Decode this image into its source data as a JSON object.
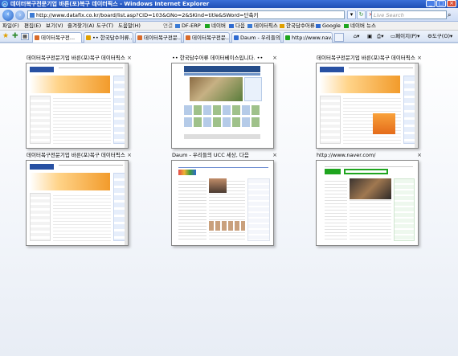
{
  "window": {
    "title": "데이터복구전문기업 바른(포)복구 데이터픽스 - Windows Internet Explorer"
  },
  "address_bar": {
    "url": "http://www.datafix.co.kr/board/list.asp?CID=103&GNo=2&SKind=title&SWord=단축키",
    "search_placeholder": "Live Search"
  },
  "menu": {
    "items": [
      "파일(F)",
      "편집(E)",
      "보기(V)",
      "즐겨찾기(A)",
      "도구(T)",
      "도움말(H)"
    ],
    "links_label": "연결",
    "links": [
      "DF-ERP",
      "네이버",
      "다음",
      "데이터픽스",
      "한국담수어류",
      "Google",
      "네이버 뉴스"
    ]
  },
  "tabs": {
    "items": [
      "데이터복구전...",
      "•• 한국담수어류...",
      "데이터복구전문...",
      "데이터복구전문...",
      "Daum - 우리들의...",
      "http://www.nav..."
    ],
    "commands": [
      "페이지(P)",
      "도구(O)"
    ]
  },
  "quick_tabs": [
    {
      "title": "데이터복구전문기업 바른(포)복구 데이터픽스",
      "kind": "datafix"
    },
    {
      "title": "•• 한국담수어류 데이터베이스입니다. ••",
      "kind": "fish"
    },
    {
      "title": "데이터복구전문기업 바른(포)복구 데이터픽스",
      "kind": "datafix"
    },
    {
      "title": "데이터복구전문기업 바른(포)복구 데이터픽스",
      "kind": "datafix"
    },
    {
      "title": "Daum - 우리들의 UCC 세상, 다음",
      "kind": "daum"
    },
    {
      "title": "http://www.naver.com/",
      "kind": "naver"
    }
  ],
  "colors": {
    "title_bar": "#1f4fb5",
    "naver_green": "#1fa51f"
  }
}
